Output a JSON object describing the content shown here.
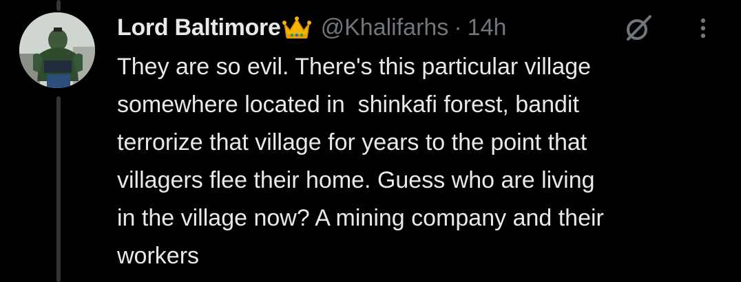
{
  "tweet": {
    "author": {
      "display_name": "Lord Baltimore",
      "badge_emoji": "👑",
      "badge_icon": "crown-icon",
      "handle": "@Khalifarhs",
      "separator": "·",
      "timestamp": "14h"
    },
    "text": "They are so evil. There's this particular village\nsomewhere located in  shinkafi forest, bandit\nterrorize that village for years to the point that\nvillagers flee their home. Guess who are living\nin the village now? A mining company and their\nworkers",
    "actions": {
      "grok_icon": "slashed-circle-icon",
      "more_icon": "vertical-ellipsis-icon"
    }
  },
  "colors": {
    "background": "#000000",
    "primary_text": "#e7e9ea",
    "secondary_text": "#71767b",
    "thread_line": "#333639",
    "crown_gold": "#f4b400"
  }
}
